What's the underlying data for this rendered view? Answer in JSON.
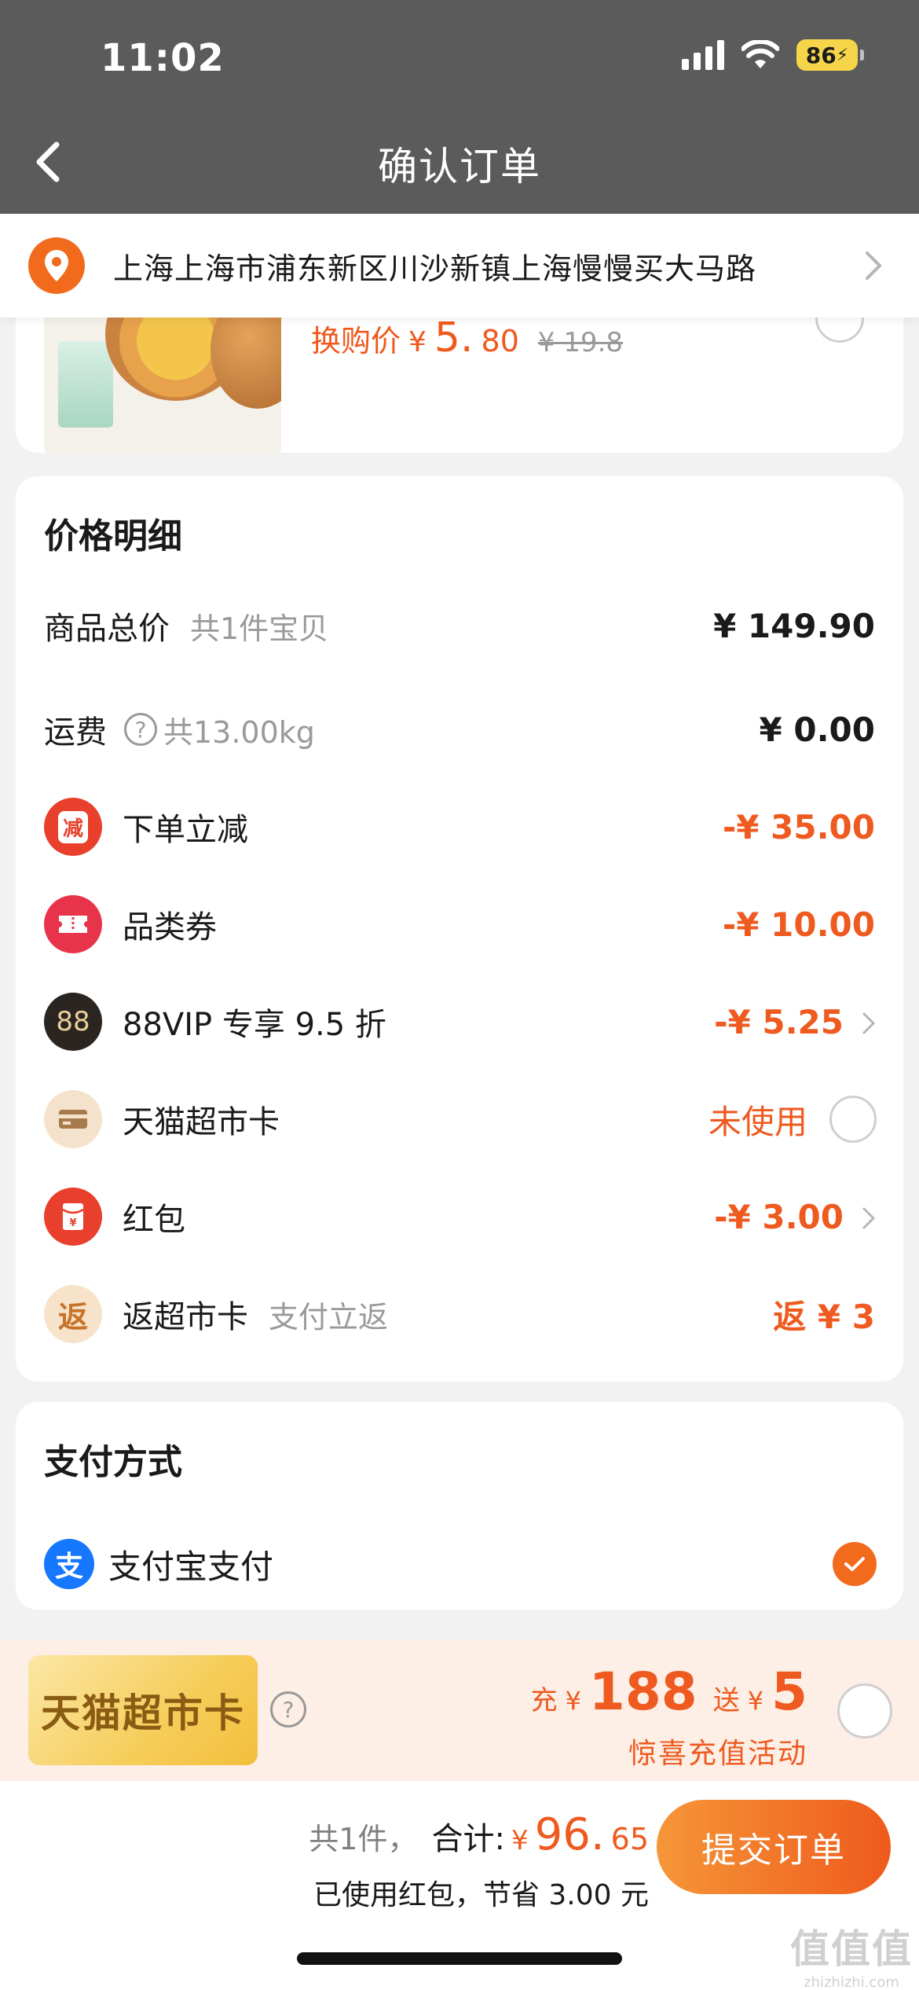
{
  "status_bar": {
    "time": "11:02",
    "battery": "86"
  },
  "nav": {
    "title": "确认订单"
  },
  "address": {
    "text": "上海上海市浦东新区川沙新镇上海慢慢买大马路"
  },
  "product": {
    "price_label": "换购价",
    "currency": "¥",
    "price_int": "5.",
    "price_dec": "80",
    "original_price": "¥ 19.8"
  },
  "price_detail": {
    "title": "价格明细",
    "rows": [
      {
        "label": "商品总价",
        "sub": "共1件宝贝",
        "value": "¥ 149.90"
      },
      {
        "label": "运费",
        "sub": "共13.00kg",
        "value": "¥ 0.00"
      },
      {
        "icon_text": "减",
        "label": "下单立减",
        "value": "-¥ 35.00"
      },
      {
        "label": "品类券",
        "value": "-¥ 10.00"
      },
      {
        "icon_text": "88",
        "label": "88VIP 专享 9.5 折",
        "value": "-¥ 5.25"
      },
      {
        "label": "天猫超市卡",
        "value": "未使用"
      },
      {
        "label": "红包",
        "value": "-¥ 3.00"
      },
      {
        "icon_text": "返",
        "label": "返超市卡",
        "sub": "支付立返",
        "value": "返 ¥ 3"
      }
    ]
  },
  "payment": {
    "title": "支付方式",
    "icon_text": "支",
    "method": "支付宝支付"
  },
  "promo": {
    "card_text": "天猫超市卡",
    "charge_label": "充",
    "charge_sym": "¥",
    "charge_amount": "188",
    "bonus_label": "送",
    "bonus_sym": "¥",
    "bonus_amount": "5",
    "subtitle": "惊喜充值活动"
  },
  "bottom": {
    "count": "共1件，",
    "total_label": "合计:",
    "total_sym": "¥",
    "total_int": "96.",
    "total_dec": "65",
    "saving": "已使用红包，节省 3.00 元",
    "submit": "提交订单"
  },
  "watermark": {
    "main": "值值值",
    "sub": "zhizhizhi.com"
  },
  "colors": {
    "accent": "#ee5a1f",
    "alipay": "#1677ff",
    "nav_bg": "#5b5b5b"
  }
}
